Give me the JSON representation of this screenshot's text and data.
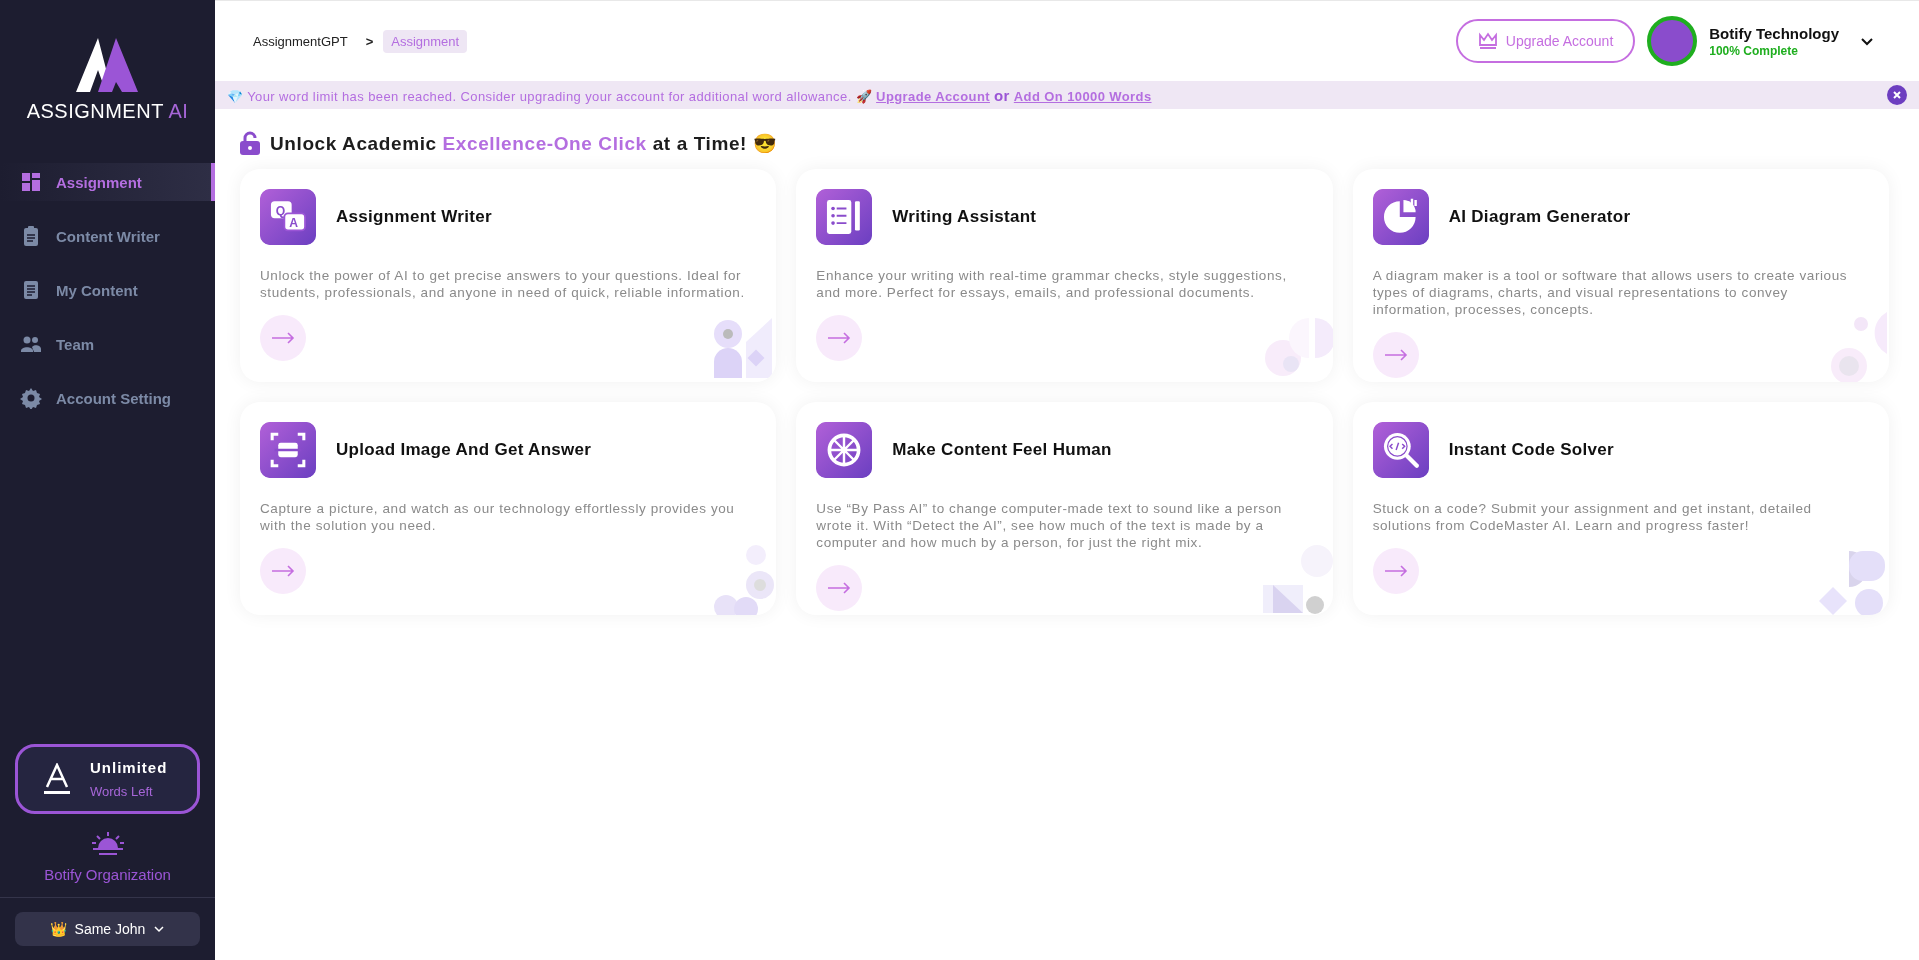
{
  "sidebar": {
    "logo": {
      "text": "ASSIGNMENT",
      "accent": "AI"
    },
    "items": [
      {
        "label": "Assignment",
        "selected": true
      },
      {
        "label": "Content Writer",
        "selected": false
      },
      {
        "label": "My Content",
        "selected": false
      },
      {
        "label": "Team",
        "selected": false
      },
      {
        "label": "Account Setting",
        "selected": false
      }
    ],
    "words_card": {
      "title": "Unlimited",
      "subtitle": "Words Left"
    },
    "organization": "Botify Organization",
    "user": {
      "emoji": "👑",
      "name": "Same John"
    }
  },
  "breadcrumb": [
    {
      "label": "AssignmentGPT",
      "selected": false
    },
    {
      "label": "Assignment",
      "selected": true
    }
  ],
  "breadcrumb_separator": ">",
  "header": {
    "upgrade_button": "Upgrade Account",
    "profile": {
      "name": "Botify Technology",
      "status": "100% Complete"
    }
  },
  "notice": {
    "emoji": "💎",
    "text": "Your word limit has been reached. Consider upgrading your account for additional word allowance.",
    "rocket": "🚀",
    "link_1": "Upgrade Account",
    "joiner": "or",
    "link_2": "Add On 10000 Words"
  },
  "heading": {
    "before": "Unlock Academic",
    "highlight": "Excellence-One Click",
    "after": "at a Time!",
    "emoji": "😎"
  },
  "cards": [
    {
      "title": "Assignment Writer",
      "icon_letters": [
        "Q",
        "A"
      ],
      "description": "Unlock the power of AI to get precise answers to your questions. Ideal for students, professionals, and anyone in need of quick, reliable information."
    },
    {
      "title": "Writing Assistant",
      "description": "Enhance your writing with real-time grammar checks, style suggestions, and more. Perfect for essays, emails, and professional documents."
    },
    {
      "title": "AI Diagram Generator",
      "description": "A diagram maker is a tool or software that allows users to create various types of diagrams, charts, and visual representations to convey information, processes, concepts."
    },
    {
      "title": "Upload Image And Get Answer",
      "description": "Capture a picture, and watch as our technology effortlessly provides you with the solution you need."
    },
    {
      "title": "Make Content Feel Human",
      "description": "Use “By Pass AI” to change computer-made text to sound like a person wrote it. With “Detect the AI”, see how much of the text is made by a computer and how much by a person, for just the right mix."
    },
    {
      "title": "Instant Code Solver",
      "description": "Stuck on a code? Submit your assignment and get instant, detailed solutions from CodeMaster AI. Learn and progress faster!"
    }
  ]
}
